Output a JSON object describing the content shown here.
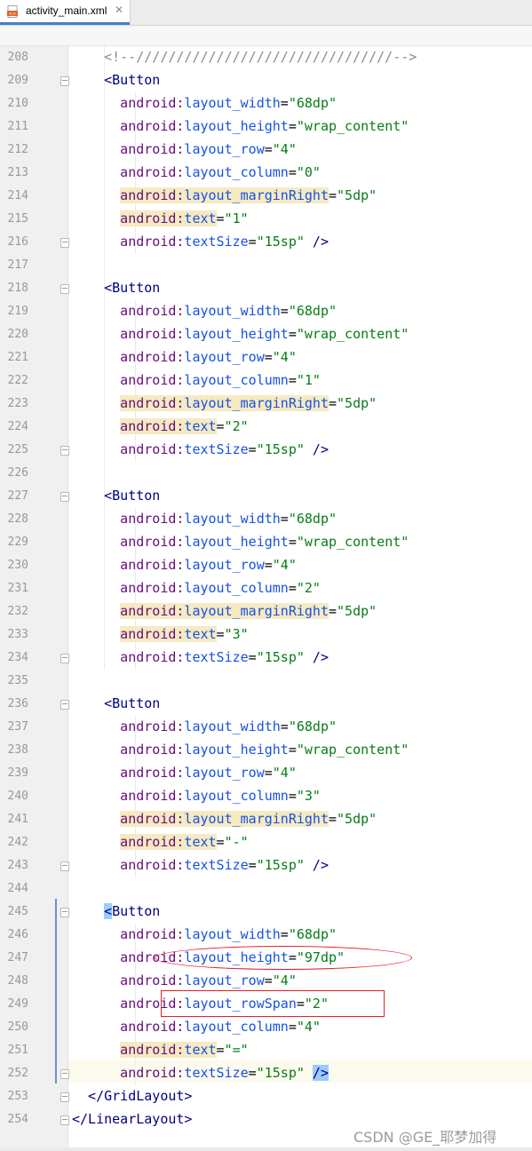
{
  "tab": {
    "filename": "activity_main.xml",
    "close_glyph": "✕",
    "icon": "xml-file-icon"
  },
  "lines": [
    {
      "no": "208",
      "indent": 4,
      "fold": "",
      "segs": [
        {
          "c": "cmt",
          "t": "<!--////////////////////////////////-->"
        }
      ]
    },
    {
      "no": "209",
      "indent": 4,
      "fold": "open",
      "segs": [
        {
          "c": "tag",
          "t": "<Button"
        }
      ]
    },
    {
      "no": "210",
      "indent": 6,
      "fold": "",
      "segs": [
        {
          "c": "ns",
          "t": "android:"
        },
        {
          "c": "aname",
          "t": "layout_width"
        },
        {
          "c": "plain",
          "t": "="
        },
        {
          "c": "val",
          "t": "\"68dp\""
        }
      ]
    },
    {
      "no": "211",
      "indent": 6,
      "fold": "",
      "segs": [
        {
          "c": "ns",
          "t": "android:"
        },
        {
          "c": "aname",
          "t": "layout_height"
        },
        {
          "c": "plain",
          "t": "="
        },
        {
          "c": "val",
          "t": "\"wrap_content\""
        }
      ]
    },
    {
      "no": "212",
      "indent": 6,
      "fold": "",
      "segs": [
        {
          "c": "ns",
          "t": "android:"
        },
        {
          "c": "aname",
          "t": "layout_row"
        },
        {
          "c": "plain",
          "t": "="
        },
        {
          "c": "val",
          "t": "\"4\""
        }
      ]
    },
    {
      "no": "213",
      "indent": 6,
      "fold": "",
      "segs": [
        {
          "c": "ns",
          "t": "android:"
        },
        {
          "c": "aname",
          "t": "layout_column"
        },
        {
          "c": "plain",
          "t": "="
        },
        {
          "c": "val",
          "t": "\"0\""
        }
      ]
    },
    {
      "no": "214",
      "indent": 6,
      "fold": "",
      "hl": true,
      "segs": [
        {
          "c": "ns",
          "t": "android:"
        },
        {
          "c": "aname",
          "t": "layout_marginRight"
        },
        {
          "c": "plain",
          "t": "="
        },
        {
          "c": "val",
          "t": "\"5dp\""
        }
      ]
    },
    {
      "no": "215",
      "indent": 6,
      "fold": "",
      "hl": true,
      "segs": [
        {
          "c": "ns",
          "t": "android:"
        },
        {
          "c": "aname",
          "t": "text"
        },
        {
          "c": "plain",
          "t": "="
        },
        {
          "c": "val",
          "t": "\"1\""
        }
      ]
    },
    {
      "no": "216",
      "indent": 6,
      "fold": "close",
      "segs": [
        {
          "c": "ns",
          "t": "android:"
        },
        {
          "c": "aname",
          "t": "textSize"
        },
        {
          "c": "plain",
          "t": "="
        },
        {
          "c": "val",
          "t": "\"15sp\""
        },
        {
          "c": "tag",
          "t": " />"
        }
      ]
    },
    {
      "no": "217",
      "indent": 0,
      "fold": "",
      "segs": []
    },
    {
      "no": "218",
      "indent": 4,
      "fold": "open",
      "segs": [
        {
          "c": "tag",
          "t": "<Button"
        }
      ]
    },
    {
      "no": "219",
      "indent": 6,
      "fold": "",
      "segs": [
        {
          "c": "ns",
          "t": "android:"
        },
        {
          "c": "aname",
          "t": "layout_width"
        },
        {
          "c": "plain",
          "t": "="
        },
        {
          "c": "val",
          "t": "\"68dp\""
        }
      ]
    },
    {
      "no": "220",
      "indent": 6,
      "fold": "",
      "segs": [
        {
          "c": "ns",
          "t": "android:"
        },
        {
          "c": "aname",
          "t": "layout_height"
        },
        {
          "c": "plain",
          "t": "="
        },
        {
          "c": "val",
          "t": "\"wrap_content\""
        }
      ]
    },
    {
      "no": "221",
      "indent": 6,
      "fold": "",
      "segs": [
        {
          "c": "ns",
          "t": "android:"
        },
        {
          "c": "aname",
          "t": "layout_row"
        },
        {
          "c": "plain",
          "t": "="
        },
        {
          "c": "val",
          "t": "\"4\""
        }
      ]
    },
    {
      "no": "222",
      "indent": 6,
      "fold": "",
      "segs": [
        {
          "c": "ns",
          "t": "android:"
        },
        {
          "c": "aname",
          "t": "layout_column"
        },
        {
          "c": "plain",
          "t": "="
        },
        {
          "c": "val",
          "t": "\"1\""
        }
      ]
    },
    {
      "no": "223",
      "indent": 6,
      "fold": "",
      "hl": true,
      "segs": [
        {
          "c": "ns",
          "t": "android:"
        },
        {
          "c": "aname",
          "t": "layout_marginRight"
        },
        {
          "c": "plain",
          "t": "="
        },
        {
          "c": "val",
          "t": "\"5dp\""
        }
      ]
    },
    {
      "no": "224",
      "indent": 6,
      "fold": "",
      "hl": true,
      "segs": [
        {
          "c": "ns",
          "t": "android:"
        },
        {
          "c": "aname",
          "t": "text"
        },
        {
          "c": "plain",
          "t": "="
        },
        {
          "c": "val",
          "t": "\"2\""
        }
      ]
    },
    {
      "no": "225",
      "indent": 6,
      "fold": "close",
      "segs": [
        {
          "c": "ns",
          "t": "android:"
        },
        {
          "c": "aname",
          "t": "textSize"
        },
        {
          "c": "plain",
          "t": "="
        },
        {
          "c": "val",
          "t": "\"15sp\""
        },
        {
          "c": "tag",
          "t": " />"
        }
      ]
    },
    {
      "no": "226",
      "indent": 0,
      "fold": "",
      "segs": []
    },
    {
      "no": "227",
      "indent": 4,
      "fold": "open",
      "segs": [
        {
          "c": "tag",
          "t": "<Button"
        }
      ]
    },
    {
      "no": "228",
      "indent": 6,
      "fold": "",
      "segs": [
        {
          "c": "ns",
          "t": "android:"
        },
        {
          "c": "aname",
          "t": "layout_width"
        },
        {
          "c": "plain",
          "t": "="
        },
        {
          "c": "val",
          "t": "\"68dp\""
        }
      ]
    },
    {
      "no": "229",
      "indent": 6,
      "fold": "",
      "segs": [
        {
          "c": "ns",
          "t": "android:"
        },
        {
          "c": "aname",
          "t": "layout_height"
        },
        {
          "c": "plain",
          "t": "="
        },
        {
          "c": "val",
          "t": "\"wrap_content\""
        }
      ]
    },
    {
      "no": "230",
      "indent": 6,
      "fold": "",
      "segs": [
        {
          "c": "ns",
          "t": "android:"
        },
        {
          "c": "aname",
          "t": "layout_row"
        },
        {
          "c": "plain",
          "t": "="
        },
        {
          "c": "val",
          "t": "\"4\""
        }
      ]
    },
    {
      "no": "231",
      "indent": 6,
      "fold": "",
      "segs": [
        {
          "c": "ns",
          "t": "android:"
        },
        {
          "c": "aname",
          "t": "layout_column"
        },
        {
          "c": "plain",
          "t": "="
        },
        {
          "c": "val",
          "t": "\"2\""
        }
      ]
    },
    {
      "no": "232",
      "indent": 6,
      "fold": "",
      "hl": true,
      "segs": [
        {
          "c": "ns",
          "t": "android:"
        },
        {
          "c": "aname",
          "t": "layout_marginRight"
        },
        {
          "c": "plain",
          "t": "="
        },
        {
          "c": "val",
          "t": "\"5dp\""
        }
      ]
    },
    {
      "no": "233",
      "indent": 6,
      "fold": "",
      "hl": true,
      "segs": [
        {
          "c": "ns",
          "t": "android:"
        },
        {
          "c": "aname",
          "t": "text"
        },
        {
          "c": "plain",
          "t": "="
        },
        {
          "c": "val",
          "t": "\"3\""
        }
      ]
    },
    {
      "no": "234",
      "indent": 6,
      "fold": "close",
      "segs": [
        {
          "c": "ns",
          "t": "android:"
        },
        {
          "c": "aname",
          "t": "textSize"
        },
        {
          "c": "plain",
          "t": "="
        },
        {
          "c": "val",
          "t": "\"15sp\""
        },
        {
          "c": "tag",
          "t": " />"
        }
      ]
    },
    {
      "no": "235",
      "indent": 0,
      "fold": "",
      "segs": []
    },
    {
      "no": "236",
      "indent": 4,
      "fold": "open",
      "segs": [
        {
          "c": "tag",
          "t": "<Button"
        }
      ]
    },
    {
      "no": "237",
      "indent": 6,
      "fold": "",
      "segs": [
        {
          "c": "ns",
          "t": "android:"
        },
        {
          "c": "aname",
          "t": "layout_width"
        },
        {
          "c": "plain",
          "t": "="
        },
        {
          "c": "val",
          "t": "\"68dp\""
        }
      ]
    },
    {
      "no": "238",
      "indent": 6,
      "fold": "",
      "segs": [
        {
          "c": "ns",
          "t": "android:"
        },
        {
          "c": "aname",
          "t": "layout_height"
        },
        {
          "c": "plain",
          "t": "="
        },
        {
          "c": "val",
          "t": "\"wrap_content\""
        }
      ]
    },
    {
      "no": "239",
      "indent": 6,
      "fold": "",
      "segs": [
        {
          "c": "ns",
          "t": "android:"
        },
        {
          "c": "aname",
          "t": "layout_row"
        },
        {
          "c": "plain",
          "t": "="
        },
        {
          "c": "val",
          "t": "\"4\""
        }
      ]
    },
    {
      "no": "240",
      "indent": 6,
      "fold": "",
      "segs": [
        {
          "c": "ns",
          "t": "android:"
        },
        {
          "c": "aname",
          "t": "layout_column"
        },
        {
          "c": "plain",
          "t": "="
        },
        {
          "c": "val",
          "t": "\"3\""
        }
      ]
    },
    {
      "no": "241",
      "indent": 6,
      "fold": "",
      "hl": true,
      "segs": [
        {
          "c": "ns",
          "t": "android:"
        },
        {
          "c": "aname",
          "t": "layout_marginRight"
        },
        {
          "c": "plain",
          "t": "="
        },
        {
          "c": "val",
          "t": "\"5dp\""
        }
      ]
    },
    {
      "no": "242",
      "indent": 6,
      "fold": "",
      "hl": true,
      "segs": [
        {
          "c": "ns",
          "t": "android:"
        },
        {
          "c": "aname",
          "t": "text"
        },
        {
          "c": "plain",
          "t": "="
        },
        {
          "c": "val",
          "t": "\"-\""
        }
      ]
    },
    {
      "no": "243",
      "indent": 6,
      "fold": "close",
      "segs": [
        {
          "c": "ns",
          "t": "android:"
        },
        {
          "c": "aname",
          "t": "textSize"
        },
        {
          "c": "plain",
          "t": "="
        },
        {
          "c": "val",
          "t": "\"15sp\""
        },
        {
          "c": "tag",
          "t": " />"
        }
      ]
    },
    {
      "no": "244",
      "indent": 0,
      "fold": "",
      "segs": []
    },
    {
      "no": "245",
      "indent": 4,
      "fold": "open",
      "segs": [
        {
          "c": "bracket",
          "t": "<"
        },
        {
          "c": "tag",
          "t": "Button"
        }
      ]
    },
    {
      "no": "246",
      "indent": 6,
      "fold": "",
      "segs": [
        {
          "c": "ns",
          "t": "android:"
        },
        {
          "c": "aname",
          "t": "layout_width"
        },
        {
          "c": "plain",
          "t": "="
        },
        {
          "c": "val",
          "t": "\"68dp\""
        }
      ]
    },
    {
      "no": "247",
      "indent": 6,
      "fold": "",
      "segs": [
        {
          "c": "ns",
          "t": "android:"
        },
        {
          "c": "aname",
          "t": "layout_height"
        },
        {
          "c": "plain",
          "t": "="
        },
        {
          "c": "val",
          "t": "\"97dp\""
        }
      ]
    },
    {
      "no": "248",
      "indent": 6,
      "fold": "",
      "segs": [
        {
          "c": "ns",
          "t": "android:"
        },
        {
          "c": "aname",
          "t": "layout_row"
        },
        {
          "c": "plain",
          "t": "="
        },
        {
          "c": "val",
          "t": "\"4\""
        }
      ]
    },
    {
      "no": "249",
      "indent": 6,
      "fold": "",
      "segs": [
        {
          "c": "ns",
          "t": "android:"
        },
        {
          "c": "aname",
          "t": "layout_rowSpan"
        },
        {
          "c": "plain",
          "t": "="
        },
        {
          "c": "val",
          "t": "\"2\""
        }
      ]
    },
    {
      "no": "250",
      "indent": 6,
      "fold": "",
      "segs": [
        {
          "c": "ns",
          "t": "android:"
        },
        {
          "c": "aname",
          "t": "layout_column"
        },
        {
          "c": "plain",
          "t": "="
        },
        {
          "c": "val",
          "t": "\"4\""
        }
      ]
    },
    {
      "no": "251",
      "indent": 6,
      "fold": "",
      "hl": true,
      "segs": [
        {
          "c": "ns",
          "t": "android:"
        },
        {
          "c": "aname",
          "t": "text"
        },
        {
          "c": "plain",
          "t": "="
        },
        {
          "c": "val",
          "t": "\"=\""
        }
      ]
    },
    {
      "no": "252",
      "indent": 6,
      "fold": "close",
      "segs": [
        {
          "c": "ns",
          "t": "android:"
        },
        {
          "c": "aname",
          "t": "textSize"
        },
        {
          "c": "plain",
          "t": "="
        },
        {
          "c": "val",
          "t": "\"15sp\""
        },
        {
          "c": "plain",
          "t": " "
        },
        {
          "c": "bracket",
          "t": "/>"
        }
      ]
    },
    {
      "no": "253",
      "indent": 2,
      "fold": "close",
      "segs": [
        {
          "c": "tag",
          "t": "</GridLayout>"
        }
      ]
    },
    {
      "no": "254",
      "indent": 0,
      "fold": "close",
      "segs": [
        {
          "c": "tag",
          "t": "</LinearLayout>"
        }
      ]
    }
  ],
  "watermark": "CSDN @GE_耶梦加得",
  "colors": {
    "tag": "#000080",
    "namespace": "#660e7a",
    "attribute": "#1750eb",
    "value": "#067d17",
    "comment": "#8c8c8c",
    "highlight": "#f5eac1",
    "annotation": "#e0202a"
  }
}
